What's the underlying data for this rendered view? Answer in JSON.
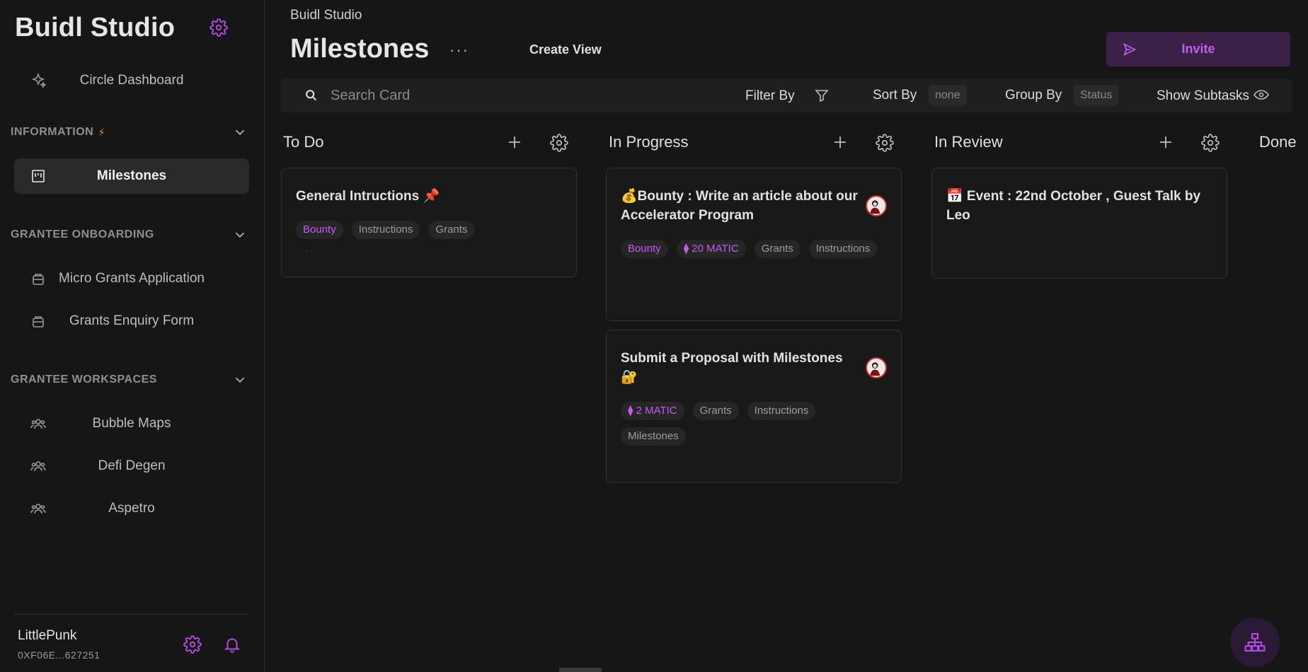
{
  "sidebar": {
    "workspace_title": "Buidl Studio",
    "dashboard_label": "Circle Dashboard",
    "sections": [
      {
        "title": "INFORMATION",
        "has_bolt": true,
        "bolt": "⚡",
        "items": [
          {
            "label": "Milestones",
            "icon": "kanban-icon",
            "active": true
          }
        ]
      },
      {
        "title": "GRANTEE ONBOARDING",
        "items": [
          {
            "label": "Micro Grants Application",
            "icon": "form-icon"
          },
          {
            "label": "Grants Enquiry Form",
            "icon": "form-icon"
          }
        ]
      },
      {
        "title": "GRANTEE WORKSPACES",
        "items": [
          {
            "label": "Bubble Maps",
            "icon": "people-icon"
          },
          {
            "label": "Defi Degen",
            "icon": "people-icon"
          },
          {
            "label": "Aspetro",
            "icon": "people-icon"
          }
        ]
      }
    ],
    "user": {
      "name": "LittlePunk",
      "address": "0XF06E...627251"
    }
  },
  "header": {
    "breadcrumb": "Buidl Studio",
    "title": "Milestones",
    "more": "···",
    "create_view": "Create View",
    "invite": "Invite"
  },
  "toolbar": {
    "search_placeholder": "Search Card",
    "filter_label": "Filter By",
    "sort_label": "Sort By",
    "sort_value": "none",
    "group_label": "Group By",
    "group_value": "Status",
    "subtasks_label": "Show Subtasks"
  },
  "columns": [
    {
      "title": "To Do"
    },
    {
      "title": "In Progress"
    },
    {
      "title": "In Review"
    },
    {
      "title": "Done"
    }
  ],
  "cards": {
    "todo_1": {
      "title": "General Intructions 📌",
      "tags": [
        "Bounty",
        "Instructions",
        "Grants"
      ]
    },
    "progress_1": {
      "title": "💰Bounty : Write an article about our Accelerator Program",
      "tags": [
        "Bounty",
        "⧫ 20 MATIC",
        "Grants",
        "Instructions"
      ]
    },
    "progress_2": {
      "title": "Submit a Proposal with Milestones 🔐",
      "tags": [
        "⧫ 2 MATIC",
        "Grants",
        "Instructions",
        "Milestones"
      ]
    },
    "review_1": {
      "title": "📅 Event : 22nd October , Guest Talk by Leo"
    }
  },
  "colors": {
    "accent": "#c45cf0",
    "background": "#161616",
    "card_border": "#333333"
  }
}
